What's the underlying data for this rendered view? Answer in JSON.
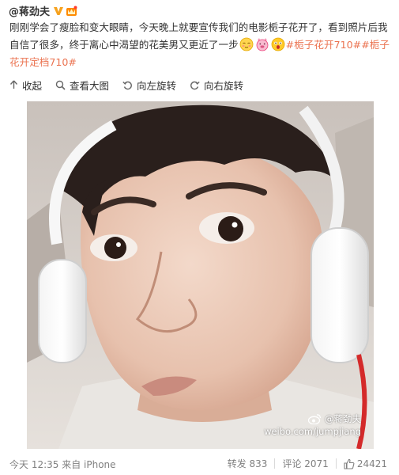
{
  "post": {
    "author": "@蒋劲夫",
    "text_part1": "刚刚学会了瘦脸和变大眼睛，今天晚上就要宣传我们的电影栀子花开了，看到照片后我自信了很多，终于离心中渴望的花美男又更近了一步",
    "hashtag1": "#栀子花开710#",
    "hashtag2": "#栀子花开定档710#",
    "emoticons": [
      "shy-face-emoticon",
      "pink-pig-emoticon",
      "shocked-face-emoticon"
    ]
  },
  "actions": {
    "collapse": "收起",
    "view_large": "查看大图",
    "rotate_left": "向左旋转",
    "rotate_right": "向右旋转"
  },
  "watermark": {
    "name": "@蒋劲夫",
    "url": "weibo.com/jumpjiang"
  },
  "footer": {
    "time_source": "今天 12:35 来自 iPhone",
    "repost_label": "转发 833",
    "comment_label": "评论 2071",
    "like_count": "24421"
  },
  "colors": {
    "link": "#eb7350",
    "meta": "#808080",
    "text": "#333333"
  }
}
